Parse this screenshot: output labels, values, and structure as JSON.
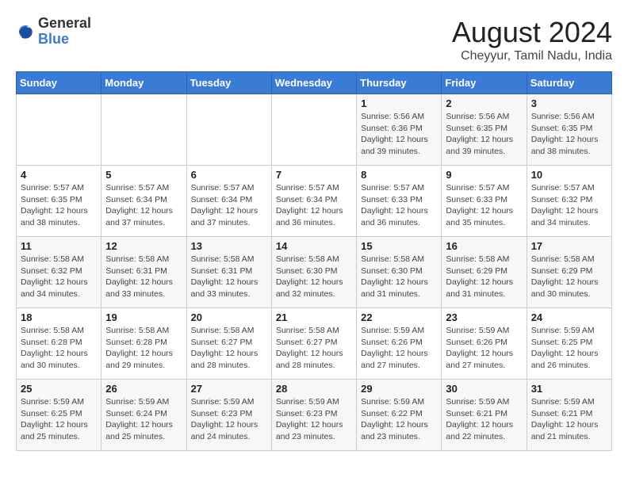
{
  "logo": {
    "general": "General",
    "blue": "Blue"
  },
  "title": {
    "month_year": "August 2024",
    "location": "Cheyyur, Tamil Nadu, India"
  },
  "headers": [
    "Sunday",
    "Monday",
    "Tuesday",
    "Wednesday",
    "Thursday",
    "Friday",
    "Saturday"
  ],
  "weeks": [
    [
      {
        "day": "",
        "info": ""
      },
      {
        "day": "",
        "info": ""
      },
      {
        "day": "",
        "info": ""
      },
      {
        "day": "",
        "info": ""
      },
      {
        "day": "1",
        "info": "Sunrise: 5:56 AM\nSunset: 6:36 PM\nDaylight: 12 hours\nand 39 minutes."
      },
      {
        "day": "2",
        "info": "Sunrise: 5:56 AM\nSunset: 6:35 PM\nDaylight: 12 hours\nand 39 minutes."
      },
      {
        "day": "3",
        "info": "Sunrise: 5:56 AM\nSunset: 6:35 PM\nDaylight: 12 hours\nand 38 minutes."
      }
    ],
    [
      {
        "day": "4",
        "info": "Sunrise: 5:57 AM\nSunset: 6:35 PM\nDaylight: 12 hours\nand 38 minutes."
      },
      {
        "day": "5",
        "info": "Sunrise: 5:57 AM\nSunset: 6:34 PM\nDaylight: 12 hours\nand 37 minutes."
      },
      {
        "day": "6",
        "info": "Sunrise: 5:57 AM\nSunset: 6:34 PM\nDaylight: 12 hours\nand 37 minutes."
      },
      {
        "day": "7",
        "info": "Sunrise: 5:57 AM\nSunset: 6:34 PM\nDaylight: 12 hours\nand 36 minutes."
      },
      {
        "day": "8",
        "info": "Sunrise: 5:57 AM\nSunset: 6:33 PM\nDaylight: 12 hours\nand 36 minutes."
      },
      {
        "day": "9",
        "info": "Sunrise: 5:57 AM\nSunset: 6:33 PM\nDaylight: 12 hours\nand 35 minutes."
      },
      {
        "day": "10",
        "info": "Sunrise: 5:57 AM\nSunset: 6:32 PM\nDaylight: 12 hours\nand 34 minutes."
      }
    ],
    [
      {
        "day": "11",
        "info": "Sunrise: 5:58 AM\nSunset: 6:32 PM\nDaylight: 12 hours\nand 34 minutes."
      },
      {
        "day": "12",
        "info": "Sunrise: 5:58 AM\nSunset: 6:31 PM\nDaylight: 12 hours\nand 33 minutes."
      },
      {
        "day": "13",
        "info": "Sunrise: 5:58 AM\nSunset: 6:31 PM\nDaylight: 12 hours\nand 33 minutes."
      },
      {
        "day": "14",
        "info": "Sunrise: 5:58 AM\nSunset: 6:30 PM\nDaylight: 12 hours\nand 32 minutes."
      },
      {
        "day": "15",
        "info": "Sunrise: 5:58 AM\nSunset: 6:30 PM\nDaylight: 12 hours\nand 31 minutes."
      },
      {
        "day": "16",
        "info": "Sunrise: 5:58 AM\nSunset: 6:29 PM\nDaylight: 12 hours\nand 31 minutes."
      },
      {
        "day": "17",
        "info": "Sunrise: 5:58 AM\nSunset: 6:29 PM\nDaylight: 12 hours\nand 30 minutes."
      }
    ],
    [
      {
        "day": "18",
        "info": "Sunrise: 5:58 AM\nSunset: 6:28 PM\nDaylight: 12 hours\nand 30 minutes."
      },
      {
        "day": "19",
        "info": "Sunrise: 5:58 AM\nSunset: 6:28 PM\nDaylight: 12 hours\nand 29 minutes."
      },
      {
        "day": "20",
        "info": "Sunrise: 5:58 AM\nSunset: 6:27 PM\nDaylight: 12 hours\nand 28 minutes."
      },
      {
        "day": "21",
        "info": "Sunrise: 5:58 AM\nSunset: 6:27 PM\nDaylight: 12 hours\nand 28 minutes."
      },
      {
        "day": "22",
        "info": "Sunrise: 5:59 AM\nSunset: 6:26 PM\nDaylight: 12 hours\nand 27 minutes."
      },
      {
        "day": "23",
        "info": "Sunrise: 5:59 AM\nSunset: 6:26 PM\nDaylight: 12 hours\nand 27 minutes."
      },
      {
        "day": "24",
        "info": "Sunrise: 5:59 AM\nSunset: 6:25 PM\nDaylight: 12 hours\nand 26 minutes."
      }
    ],
    [
      {
        "day": "25",
        "info": "Sunrise: 5:59 AM\nSunset: 6:25 PM\nDaylight: 12 hours\nand 25 minutes."
      },
      {
        "day": "26",
        "info": "Sunrise: 5:59 AM\nSunset: 6:24 PM\nDaylight: 12 hours\nand 25 minutes."
      },
      {
        "day": "27",
        "info": "Sunrise: 5:59 AM\nSunset: 6:23 PM\nDaylight: 12 hours\nand 24 minutes."
      },
      {
        "day": "28",
        "info": "Sunrise: 5:59 AM\nSunset: 6:23 PM\nDaylight: 12 hours\nand 23 minutes."
      },
      {
        "day": "29",
        "info": "Sunrise: 5:59 AM\nSunset: 6:22 PM\nDaylight: 12 hours\nand 23 minutes."
      },
      {
        "day": "30",
        "info": "Sunrise: 5:59 AM\nSunset: 6:21 PM\nDaylight: 12 hours\nand 22 minutes."
      },
      {
        "day": "31",
        "info": "Sunrise: 5:59 AM\nSunset: 6:21 PM\nDaylight: 12 hours\nand 21 minutes."
      }
    ]
  ]
}
